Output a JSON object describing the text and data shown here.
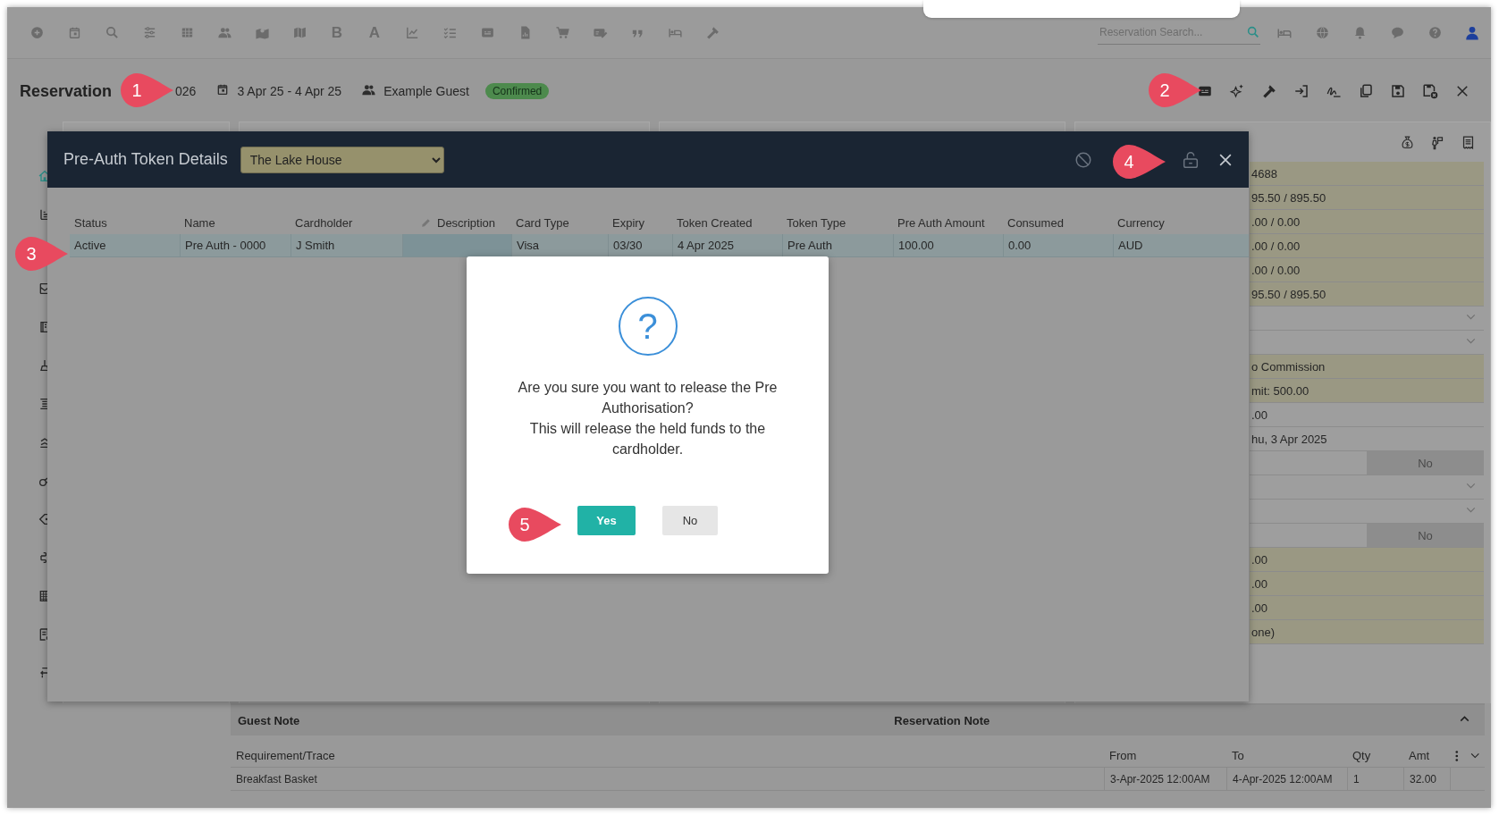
{
  "top_bar": {
    "toolbar": [
      {
        "kind": "add"
      },
      {
        "kind": "calendar"
      },
      {
        "kind": "search"
      },
      {
        "kind": "sliders"
      },
      {
        "kind": "grid"
      },
      {
        "kind": "people"
      },
      {
        "kind": "map-pin"
      },
      {
        "kind": "map"
      },
      {
        "kind": "glyph",
        "glyph": "B"
      },
      {
        "kind": "glyph",
        "glyph": "A"
      },
      {
        "kind": "chart"
      },
      {
        "kind": "checklist"
      },
      {
        "kind": "card"
      },
      {
        "kind": "report"
      },
      {
        "kind": "cart"
      },
      {
        "kind": "money-edit"
      },
      {
        "kind": "quote"
      },
      {
        "kind": "bed"
      },
      {
        "kind": "hammer"
      }
    ],
    "search": {
      "placeholder": "Reservation Search..."
    }
  },
  "header": {
    "title": "Reservation",
    "reservation_number": "026",
    "dates": "3 Apr 25 - 4 Apr 25",
    "guest": "Example Guest",
    "status": "Confirmed"
  },
  "side_panel": {
    "rows": [
      {
        "kind": "value",
        "text": "4688",
        "highlighted": true
      },
      {
        "kind": "value",
        "text": "95.50 / 895.50",
        "highlighted": true
      },
      {
        "kind": "value",
        "text": ".00 / 0.00",
        "highlighted": true
      },
      {
        "kind": "value",
        "text": ".00 / 0.00",
        "highlighted": true
      },
      {
        "kind": "value",
        "text": ".00 / 0.00",
        "highlighted": true
      },
      {
        "kind": "value",
        "text": "95.50 / 895.50",
        "highlighted": true
      },
      {
        "kind": "select"
      },
      {
        "kind": "select"
      },
      {
        "kind": "value",
        "text": "o Commission",
        "highlighted": true
      },
      {
        "kind": "value",
        "text": "mit: 500.00",
        "highlighted": true
      },
      {
        "kind": "value",
        "text": ".00",
        "highlighted": false
      },
      {
        "kind": "value",
        "text": "hu, 3 Apr 2025",
        "highlighted": false
      },
      {
        "kind": "toggle",
        "value": "No"
      },
      {
        "kind": "select"
      },
      {
        "kind": "select"
      },
      {
        "kind": "toggle",
        "value": "No"
      },
      {
        "kind": "value",
        "text": ".00",
        "highlighted": true
      },
      {
        "kind": "value",
        "text": ".00",
        "highlighted": true
      },
      {
        "kind": "value",
        "text": ".00",
        "highlighted": true
      },
      {
        "kind": "value",
        "text": "one)",
        "highlighted": true
      }
    ]
  },
  "notes": {
    "guest_note": "Guest Note",
    "reservation_note": "Reservation Note"
  },
  "requirements": {
    "columns": [
      "Requirement/Trace",
      "From",
      "To",
      "Qty",
      "Amt"
    ],
    "rows": [
      [
        "Breakfast Basket",
        "3-Apr-2025 12:00AM",
        "4-Apr-2025 12:00AM",
        "1",
        "32.00"
      ]
    ]
  },
  "token_dialog": {
    "title": "Pre-Auth Token Details",
    "property": "The Lake House",
    "columns": [
      "Status",
      "Name",
      "Cardholder",
      "Description",
      "Card Type",
      "Expiry",
      "Token Created",
      "Token Type",
      "Pre Auth Amount",
      "Consumed",
      "Currency"
    ],
    "rows": [
      {
        "selected": true,
        "cells": [
          "Active",
          "Pre Auth - 0000",
          "J Smith",
          null,
          "Visa",
          "03/30",
          "4 Apr 2025",
          "Pre Auth",
          "100.00",
          "0.00",
          "AUD"
        ]
      }
    ]
  },
  "confirm": {
    "icon": "?",
    "message": "Are you sure you want to release the Pre Authorisation?",
    "detail": "This will release the held funds to the cardholder.",
    "buttons": [
      {
        "label": "Yes",
        "kind": "primary"
      },
      {
        "label": "No",
        "kind": "secondary"
      }
    ]
  },
  "callouts": [
    {
      "number": "1"
    },
    {
      "number": "2"
    },
    {
      "number": "3"
    },
    {
      "number": "4"
    },
    {
      "number": "5"
    }
  ]
}
